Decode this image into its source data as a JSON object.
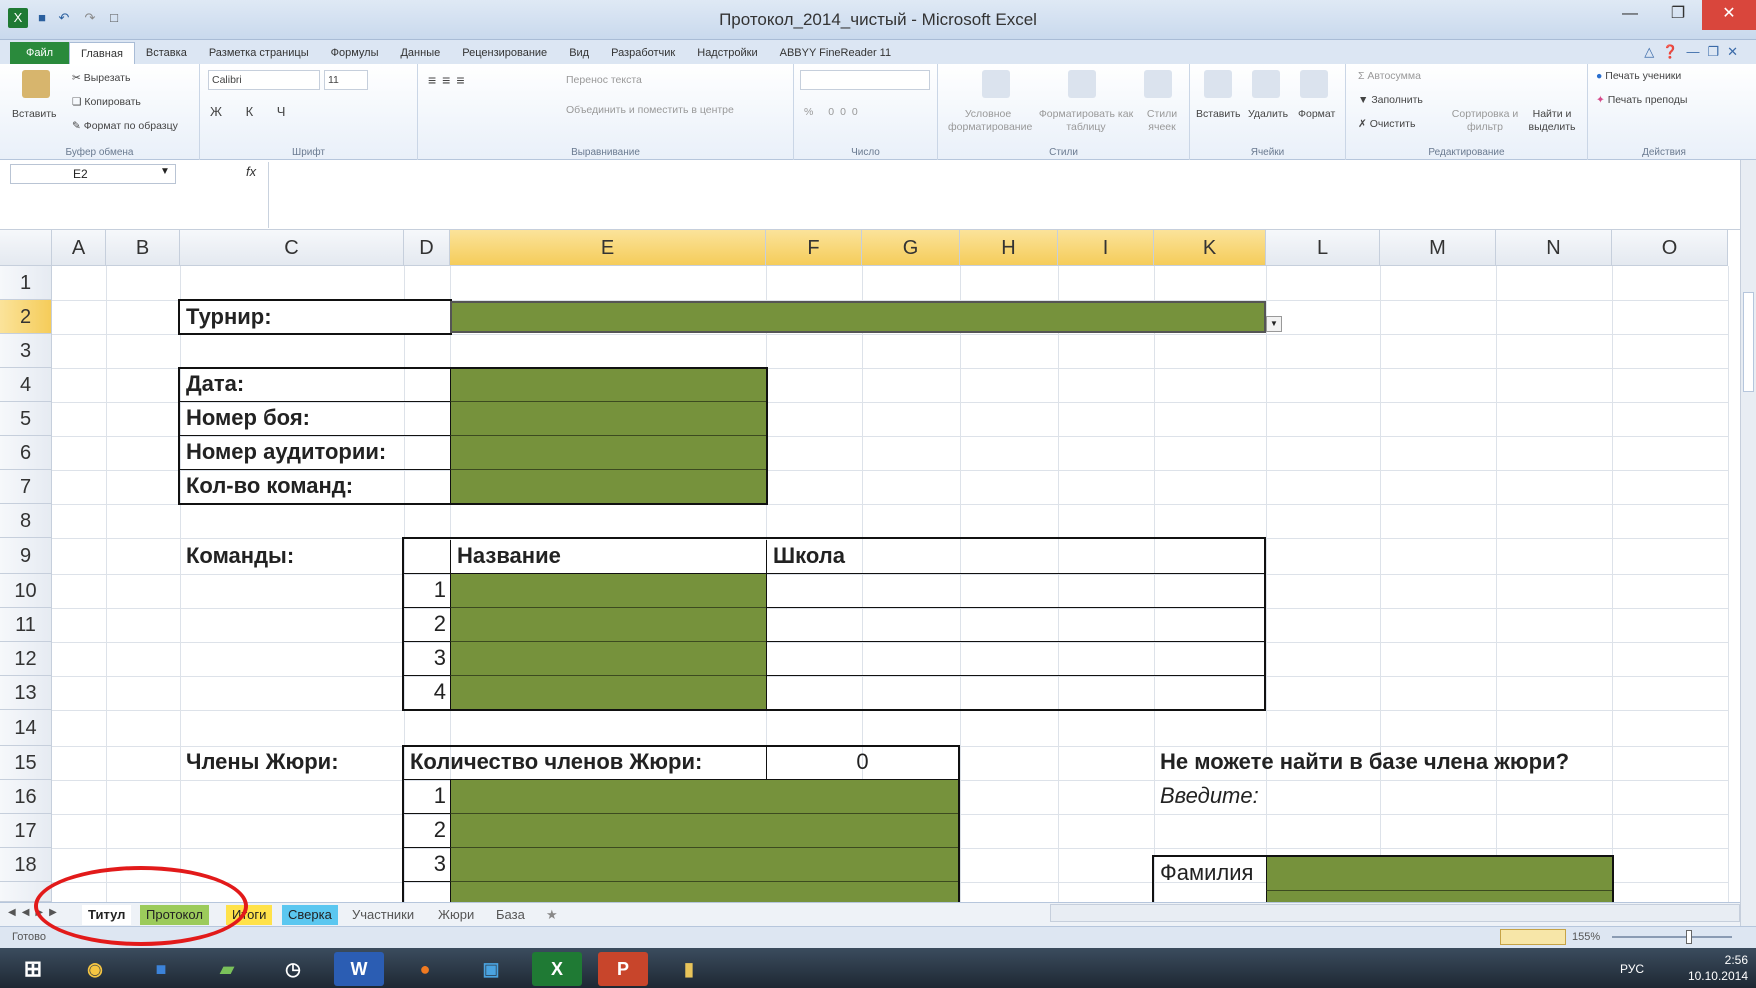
{
  "window": {
    "title": "Протокол_2014_чистый - Microsoft Excel"
  },
  "qat_icons": [
    "excel-logo-icon",
    "save-icon",
    "undo-icon",
    "redo-icon",
    "new-doc-icon"
  ],
  "ribbon_tabs": [
    "Файл",
    "Главная",
    "Вставка",
    "Разметка страницы",
    "Формулы",
    "Данные",
    "Рецензирование",
    "Вид",
    "Разработчик",
    "Надстройки",
    "ABBYY FineReader 11"
  ],
  "ribbon": {
    "clipboard": {
      "paste": "Вставить",
      "cut": "Вырезать",
      "copy": "Копировать",
      "format_painter": "Формат по образцу",
      "label": "Буфер обмена"
    },
    "font": {
      "name": "Calibri",
      "size": "11",
      "label": "Шрифт"
    },
    "alignment": {
      "wrap": "Перенос текста",
      "merge": "Объединить и поместить в центре",
      "label": "Выравнивание"
    },
    "number": {
      "label": "Число"
    },
    "styles": {
      "conditional": "Условное форматирование",
      "as_table": "Форматировать как таблицу",
      "cell_styles": "Стили ячеек",
      "label": "Стили"
    },
    "cells": {
      "insert": "Вставить",
      "delete": "Удалить",
      "format": "Формат",
      "label": "Ячейки"
    },
    "editing": {
      "autosum": "Автосумма",
      "fill": "Заполнить",
      "clear": "Очистить",
      "sort": "Сортировка и фильтр",
      "find": "Найти и выделить",
      "label": "Редактирование"
    },
    "actions": {
      "print_students": "Печать ученики",
      "print_teachers": "Печать преподы",
      "label": "Действия"
    }
  },
  "formula_bar": {
    "name_box": "E2",
    "fx": "fx",
    "value": ""
  },
  "columns": [
    "A",
    "B",
    "C",
    "D",
    "E",
    "F",
    "G",
    "H",
    "I",
    "K",
    "L",
    "M",
    "N",
    "O"
  ],
  "rows": [
    "1",
    "2",
    "3",
    "4",
    "5",
    "6",
    "7",
    "8",
    "9",
    "10",
    "11",
    "12",
    "13",
    "14",
    "15",
    "16",
    "17",
    "18"
  ],
  "sheet": {
    "tournament_label": "Турнир:",
    "date_label": "Дата:",
    "fight_label": "Номер боя:",
    "room_label": "Номер аудитории:",
    "teams_count_label": "Кол-во команд:",
    "teams_label": "Команды:",
    "teams_header_name": "Название",
    "teams_header_school": "Школа",
    "team_numbers": [
      "1",
      "2",
      "3",
      "4"
    ],
    "jury_label": "Члены Жюри:",
    "jury_count_label": "Количество членов Жюри:",
    "jury_count_value": "0",
    "jury_numbers": [
      "1",
      "2",
      "3"
    ],
    "not_found": "Не можете найти в базе члена жюри?",
    "enter": "Введите:",
    "surname": "Фамилия"
  },
  "sheet_tabs": [
    "Титул",
    "Протокол",
    "Итоги",
    "Сверка",
    "Участники",
    "Жюри",
    "База"
  ],
  "status": {
    "ready": "Готово",
    "zoom": "155%"
  },
  "taskbar": {
    "time": "2:56",
    "date": "10.10.2014",
    "lang": "РУС"
  }
}
